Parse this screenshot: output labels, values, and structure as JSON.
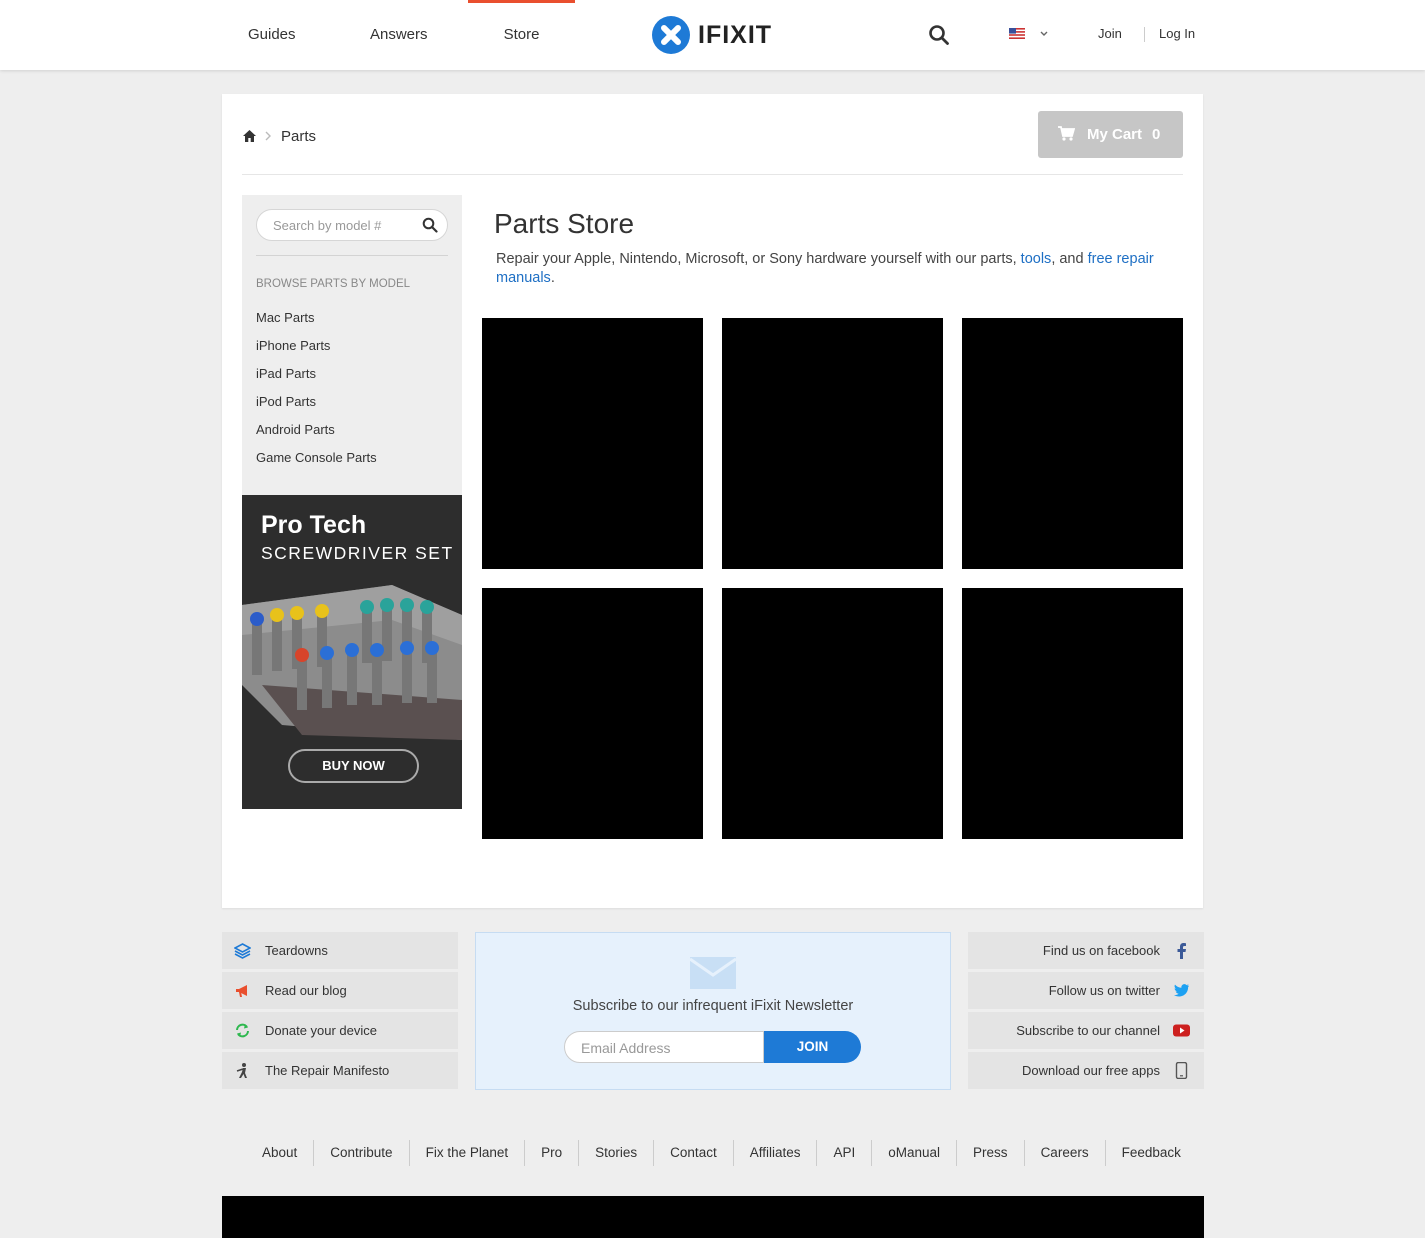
{
  "header": {
    "nav": [
      "Guides",
      "Answers",
      "Store"
    ],
    "logo_text": "IFIXIT",
    "join": "Join",
    "login": "Log In",
    "brand_color": "#1e7ad6",
    "active_color": "#e94f2e"
  },
  "breadcrumb": {
    "current": "Parts"
  },
  "cart": {
    "label": "My Cart",
    "count": "0"
  },
  "sidebar": {
    "search_placeholder": "Search by model #",
    "heading": "BROWSE PARTS BY MODEL",
    "items": [
      "Mac Parts",
      "iPhone Parts",
      "iPad Parts",
      "iPod Parts",
      "Android Parts",
      "Game Console Parts"
    ]
  },
  "ad": {
    "title": "Pro Tech",
    "subtitle": "SCREWDRIVER SET",
    "button": "BUY NOW"
  },
  "main": {
    "title": "Parts Store",
    "desc_text": "Repair your Apple, Nintendo, Microsoft, or Sony hardware yourself with our parts, ",
    "desc_link1": "tools",
    "desc_mid": ", and ",
    "desc_link2": "free repair manuals",
    "desc_end": "."
  },
  "footer": {
    "left_links": [
      "Teardowns",
      "Read our blog",
      "Donate your device",
      "The Repair Manifesto"
    ],
    "right_links": [
      "Find us on facebook",
      "Follow us on twitter",
      "Subscribe to our channel",
      "Download our free apps"
    ],
    "newsletter_text": "Subscribe to our infrequent iFixit Newsletter",
    "email_placeholder": "Email Address",
    "join_button": "JOIN",
    "bottom_links": [
      "About",
      "Contribute",
      "Fix the Planet",
      "Pro",
      "Stories",
      "Contact",
      "Affiliates",
      "API",
      "oManual",
      "Press",
      "Careers",
      "Feedback"
    ]
  }
}
